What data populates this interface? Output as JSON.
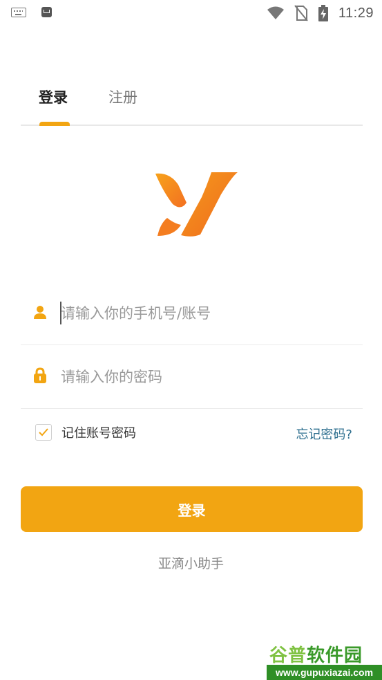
{
  "status_bar": {
    "time": "11:29",
    "icons": [
      "keyboard-icon",
      "app-notification-icon",
      "wifi-icon",
      "no-sim-icon",
      "battery-charging-icon"
    ]
  },
  "tabs": {
    "login": "登录",
    "register": "注册",
    "active": "login"
  },
  "form": {
    "phone_placeholder": "请输入你的手机号/账号",
    "phone_value": "",
    "password_placeholder": "请输入你的密码",
    "password_value": "",
    "remember_label": "记住账号密码",
    "remember_checked": true,
    "forgot_label": "忘记密码?",
    "login_button": "登录"
  },
  "app_name": "亚滴小助手",
  "watermark": {
    "title_part1": "谷普",
    "title_part2": "软件园",
    "url": "www.gupuxiazai.com"
  },
  "colors": {
    "accent": "#f2a512",
    "logo_orange": "#f37021",
    "link": "#2e6f8f"
  }
}
